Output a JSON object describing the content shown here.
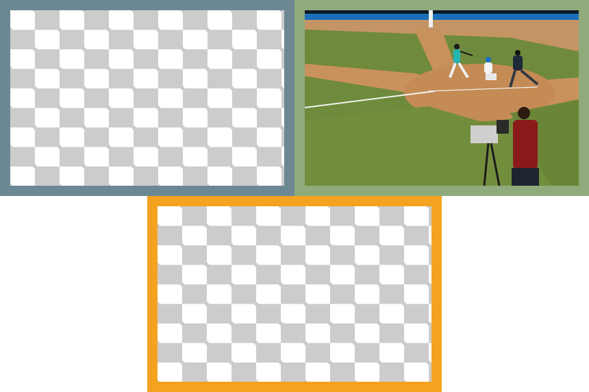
{
  "panels": [
    {
      "name": "top-left-empty-image",
      "frame_color": "#6b8894",
      "content": "transparent-checkerboard"
    },
    {
      "name": "top-right-baseball-photo",
      "frame_color": "#8fab7c",
      "content": "photo"
    },
    {
      "name": "bottom-empty-image",
      "frame_color": "#f4a320",
      "content": "transparent-checkerboard"
    }
  ],
  "checker_colors": {
    "light": "#ffffff",
    "dark": "#cccccc"
  },
  "photo_palette": {
    "grass": "#6f8a3c",
    "dirt": "#c9925c",
    "wall": "#1a6fb8",
    "chalk": "#f2f2f2"
  }
}
